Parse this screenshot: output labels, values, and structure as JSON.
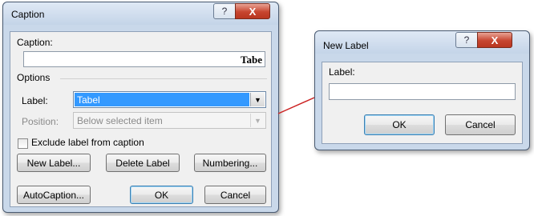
{
  "caption_dialog": {
    "title": "Caption",
    "help_glyph": "?",
    "close_glyph": "X",
    "caption_label": "Caption:",
    "caption_value": "Tabe",
    "options_label": "Options",
    "label_label": "Label:",
    "label_value": "Tabel",
    "position_label": "Position:",
    "position_value": "Below selected item",
    "exclude_label": "Exclude label from caption",
    "exclude_checked": false,
    "new_label_button": "New Label...",
    "delete_label_button": "Delete Label",
    "numbering_button": "Numbering...",
    "autocaption_button": "AutoCaption...",
    "ok_button": "OK",
    "cancel_button": "Cancel"
  },
  "new_label_dialog": {
    "title": "New Label",
    "help_glyph": "?",
    "close_glyph": "X",
    "label_label": "Label:",
    "label_value": "",
    "ok_button": "OK",
    "cancel_button": "Cancel"
  },
  "colors": {
    "selection": "#3399ff",
    "connector": "#cc2222"
  }
}
